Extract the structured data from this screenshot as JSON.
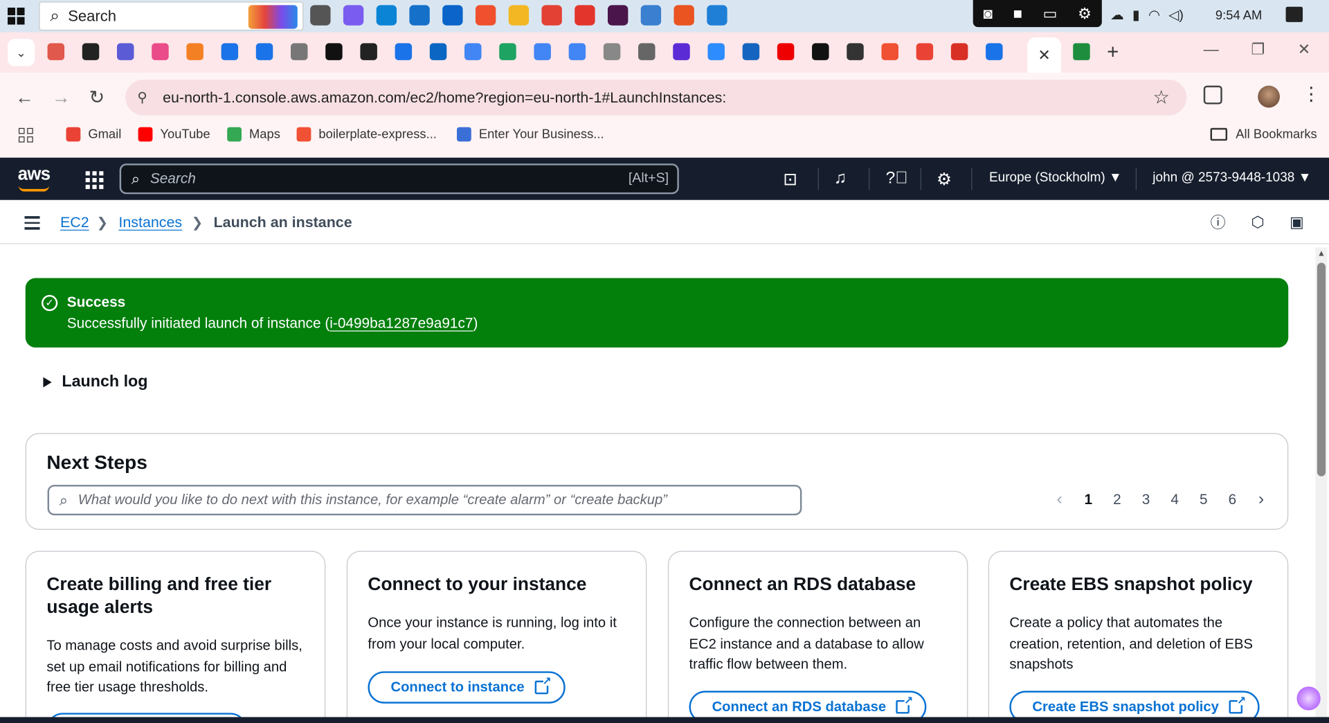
{
  "taskbar": {
    "search_label": "Search",
    "time": "9:54 AM",
    "app_icons": [
      "task-view-icon",
      "copilot-icon",
      "edge-icon",
      "store-icon",
      "outlook-icon",
      "brave-icon",
      "file-explorer-icon",
      "chrome-icon",
      "wps-icon",
      "slack-icon",
      "remote-desktop-icon",
      "ubuntu-icon",
      "vscode-icon"
    ],
    "app_colors": [
      "#555",
      "#7b5cf0",
      "#0b84d6",
      "#1570c9",
      "#0a64c9",
      "#f0502d",
      "#f2b722",
      "#e34133",
      "#e3352b",
      "#4a154b",
      "#3a7fd0",
      "#e95420",
      "#1f7fd6"
    ]
  },
  "browser": {
    "tab_favicon_colors": [
      "#e1584c",
      "#222",
      "#5b5bd6",
      "#ea4c89",
      "#f48024",
      "#1a73e8",
      "#1a73e8",
      "#777",
      "#111",
      "#222",
      "#1a73e8",
      "#0a66c2",
      "#4285f4",
      "#1ea362",
      "#4285f4",
      "#4285f4",
      "#888",
      "#666",
      "#5b2bd6",
      "#2d8cff",
      "#1565c0",
      "#e00",
      "#111",
      "#333",
      "#f05033",
      "#ea4335",
      "#d93025",
      "#1a73e8"
    ],
    "url": "eu-north-1.console.aws.amazon.com/ec2/home?region=eu-north-1#LaunchInstances:",
    "bookmarks": [
      {
        "label": "Gmail",
        "color": "#ea4335"
      },
      {
        "label": "YouTube",
        "color": "#ff0000"
      },
      {
        "label": "Maps",
        "color": "#34a853"
      },
      {
        "label": "boilerplate-express...",
        "color": "#f05033"
      },
      {
        "label": "Enter Your Business...",
        "color": "#3b6fd8"
      }
    ],
    "all_bookmarks": "All Bookmarks"
  },
  "aws_header": {
    "logo": "aws",
    "search_placeholder": "Search",
    "search_shortcut": "[Alt+S]",
    "region": "Europe (Stockholm) ▼",
    "account": "john @ 2573-9448-1038 ▼"
  },
  "breadcrumb": {
    "items": [
      "EC2",
      "Instances",
      "Launch an instance"
    ]
  },
  "flash": {
    "header": "Success",
    "message_prefix": "Successfully initiated launch of instance (",
    "instance_id": "i-0499ba1287e9a91c7",
    "message_suffix": ")"
  },
  "launch_log": "Launch log",
  "next_steps": {
    "title": "Next Steps",
    "search_placeholder": "What would you like to do next with this instance, for example “create alarm” or “create backup”",
    "pages": [
      "1",
      "2",
      "3",
      "4",
      "5",
      "6"
    ],
    "current_page": "1"
  },
  "cards": [
    {
      "title": "Create billing and free tier usage alerts",
      "body": "To manage costs and avoid surprise bills, set up email notifications for billing and free tier usage thresholds.",
      "button": ""
    },
    {
      "title": "Connect to your instance",
      "body": "Once your instance is running, log into it from your local computer.",
      "button": "Connect to instance"
    },
    {
      "title": "Connect an RDS database",
      "body": "Configure the connection between an EC2 instance and a database to allow traffic flow between them.",
      "button": "Connect an RDS database"
    },
    {
      "title": "Create EBS snapshot policy",
      "body": "Create a policy that automates the creation, retention, and deletion of EBS snapshots",
      "button": "Create EBS snapshot policy"
    }
  ],
  "colors": {
    "aws_nav": "#161e2d",
    "success": "#037f0c",
    "link": "#0972d3"
  }
}
